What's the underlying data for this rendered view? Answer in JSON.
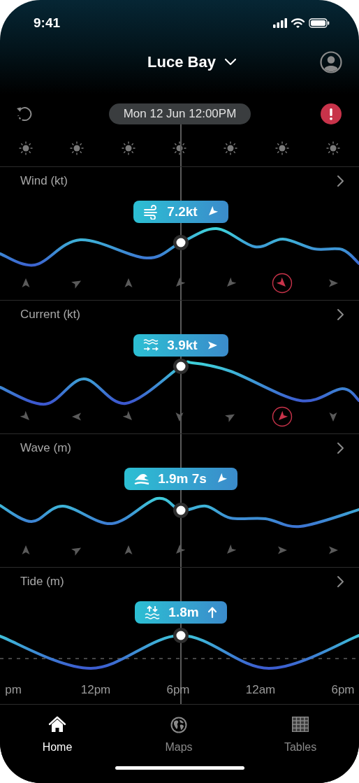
{
  "status_bar": {
    "time": "9:41"
  },
  "header": {
    "location": "Luce Bay"
  },
  "timeline": {
    "datetime": "Mon 12 Jun 12:00PM",
    "alert": true
  },
  "weather": [
    {
      "kind": "sun"
    },
    {
      "kind": "sun"
    },
    {
      "kind": "sun"
    },
    {
      "kind": "sun"
    },
    {
      "kind": "sun"
    },
    {
      "kind": "sun"
    },
    {
      "kind": "sun"
    }
  ],
  "panels": [
    {
      "kind": "wind",
      "title": "Wind (kt)",
      "reading": "7.2kt",
      "direction": {
        "kind": "sw"
      },
      "arrows": [
        {
          "kind": "n",
          "alert": false
        },
        {
          "kind": "ene",
          "alert": false
        },
        {
          "kind": "n",
          "alert": false
        },
        {
          "kind": "sw",
          "alert": false
        },
        {
          "kind": "sw",
          "alert": false
        },
        {
          "kind": "se",
          "alert": true
        },
        {
          "kind": "e",
          "alert": false
        }
      ]
    },
    {
      "kind": "current",
      "title": "Current (kt)",
      "reading": "3.9kt",
      "direction": {
        "kind": "e"
      },
      "arrows": [
        {
          "kind": "se",
          "alert": false
        },
        {
          "kind": "w",
          "alert": false
        },
        {
          "kind": "se",
          "alert": false
        },
        {
          "kind": "s",
          "alert": false
        },
        {
          "kind": "ene",
          "alert": false
        },
        {
          "kind": "sw",
          "alert": true
        },
        {
          "kind": "s",
          "alert": false
        }
      ]
    },
    {
      "kind": "wave",
      "title": "Wave (m)",
      "reading": "1.9m 7s",
      "direction": {
        "kind": "sw"
      },
      "arrows": [
        {
          "kind": "n",
          "alert": false
        },
        {
          "kind": "ene",
          "alert": false
        },
        {
          "kind": "n",
          "alert": false
        },
        {
          "kind": "sw",
          "alert": false
        },
        {
          "kind": "sw",
          "alert": false
        },
        {
          "kind": "e",
          "alert": false
        },
        {
          "kind": "e",
          "alert": false
        }
      ]
    },
    {
      "kind": "tide",
      "title": "Tide (m)",
      "reading": "1.8m",
      "direction": {
        "kind": "up"
      },
      "x_axis": [
        "pm",
        "12pm",
        "6pm",
        "12am",
        "6pm"
      ]
    }
  ],
  "tabs": [
    {
      "label": "Home",
      "kind": "home",
      "selected": true
    },
    {
      "label": "Maps",
      "kind": "maps",
      "selected": false
    },
    {
      "label": "Tables",
      "kind": "tables",
      "selected": false
    }
  ]
}
